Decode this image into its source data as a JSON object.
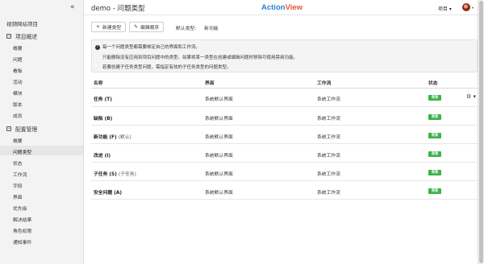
{
  "sidebar": {
    "collapse_icon": "«",
    "project": "视频网站项目",
    "section1": {
      "sign": "−",
      "label": "项目概述"
    },
    "section1_items": [
      "概要",
      "问题",
      "看板",
      "活动",
      "模块",
      "版本",
      "成员"
    ],
    "section2": {
      "sign": "−",
      "label": "配置管理"
    },
    "section2_items": [
      "概要",
      "问题类型",
      "状态",
      "工作流",
      "字段",
      "界面",
      "优先级",
      "解决结果",
      "角色权限",
      "通知事件"
    ]
  },
  "header": {
    "title": "demo - 问题类型",
    "logo_a": "Action",
    "logo_b": "View",
    "project_menu": "项目 ▾",
    "avatar_caret": "▾"
  },
  "toolbar": {
    "new_type": "新建类型",
    "new_icon": "+",
    "reorder": "编辑顺序",
    "reorder_icon": "✎",
    "default_type_label": "默认类型:",
    "default_type_value": "新功能"
  },
  "info": {
    "icon": "i",
    "line1": "每一个问题类型都需要绑定自己的界面和工作流。",
    "line2": "只能删除没有应用到项目问题中的类型。如果将某一类型在创建或编辑问题时移除可使用禁用功能。",
    "line3": "若要创建子任务类型问题，需指定有效的子任务类型的问题类型。"
  },
  "table": {
    "headers": {
      "name": "名称",
      "screen": "界面",
      "workflow": "工作流",
      "status": "状态"
    },
    "rows": [
      {
        "name": "任务 (T)",
        "sub": "",
        "screen": "系统默认界面",
        "workflow": "系统工作流",
        "status": "有效"
      },
      {
        "name": "缺陷 (B)",
        "sub": "",
        "screen": "系统默认界面",
        "workflow": "系统工作流",
        "status": "有效"
      },
      {
        "name": "新功能 (F)",
        "sub": "(默认)",
        "screen": "系统默认界面",
        "workflow": "系统工作流",
        "status": "有效"
      },
      {
        "name": "改进 (I)",
        "sub": "",
        "screen": "系统默认界面",
        "workflow": "系统工作流",
        "status": "有效"
      },
      {
        "name": "子任务 (S)",
        "sub": "(子任务)",
        "screen": "系统默认界面",
        "workflow": "系统工作流",
        "status": "有效"
      },
      {
        "name": "安全问题 (A)",
        "sub": "",
        "screen": "系统默认界面",
        "workflow": "系统工作流",
        "status": "有效"
      }
    ],
    "row_action_icon": "⚙ ▾"
  },
  "colors": {
    "badge": "#3bb24a",
    "logo_blue": "#2b7fd4",
    "logo_orange": "#e8542f"
  }
}
